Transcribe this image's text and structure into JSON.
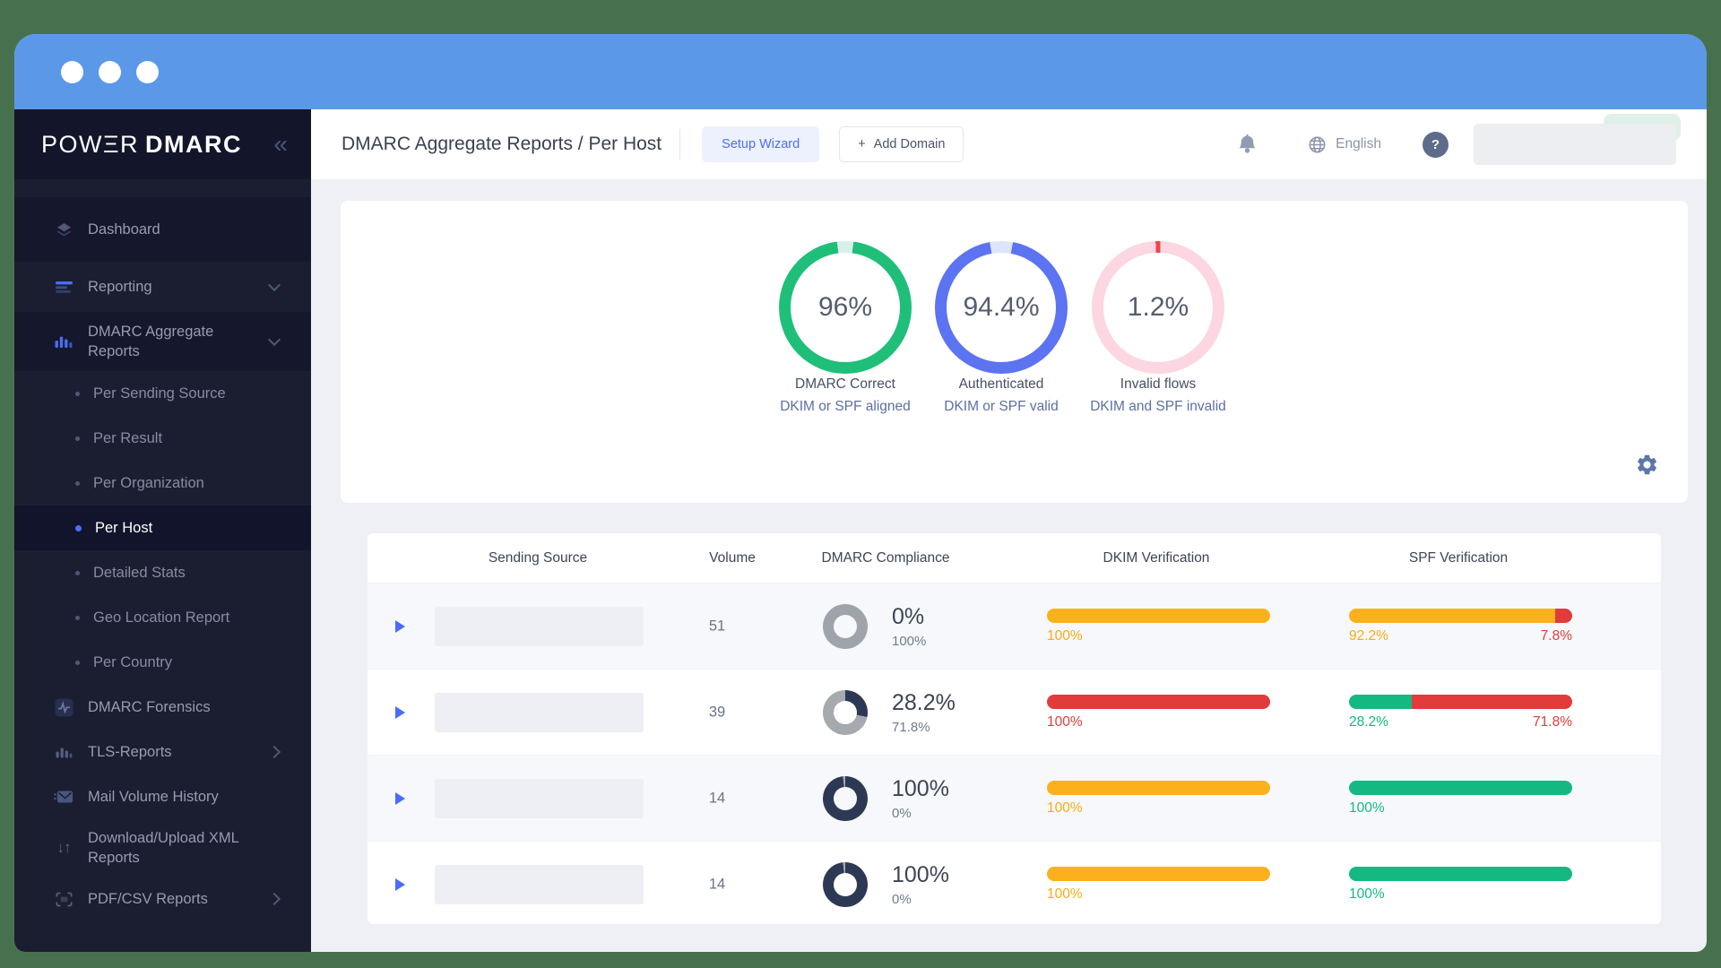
{
  "colors": {
    "desktop": "#47714e",
    "titlebar": "#5b99e8",
    "accent_blue": "#4c6cf5",
    "green": "#1fbf79",
    "amber": "#fbb11c",
    "red": "#e23b3c",
    "teal_green": "#14b981",
    "navy": "#2d3954",
    "pink": "#fcd6e0"
  },
  "sidebar": {
    "logo": {
      "thin": "POWΞR",
      "bold": "DMARC"
    },
    "collapse_glyph": "«",
    "items": [
      {
        "label": "Dashboard"
      },
      {
        "label": "Reporting"
      },
      {
        "label": "DMARC Aggregate Reports"
      },
      {
        "label": "Per Sending Source"
      },
      {
        "label": "Per Result"
      },
      {
        "label": "Per Organization"
      },
      {
        "label": "Per Host"
      },
      {
        "label": "Detailed Stats"
      },
      {
        "label": "Geo Location Report"
      },
      {
        "label": "Per Country"
      },
      {
        "label": "DMARC Forensics"
      },
      {
        "label": "TLS-Reports"
      },
      {
        "label": "Mail Volume History"
      },
      {
        "label": "Download/Upload XML Reports"
      },
      {
        "label": "PDF/CSV Reports"
      }
    ]
  },
  "header": {
    "title": "DMARC Aggregate Reports / Per Host",
    "setup_wizard_label": "Setup Wizard",
    "add_domain_plus": "+",
    "add_domain_label": "Add Domain",
    "language": "English",
    "help_glyph": "?"
  },
  "summary": {
    "donuts": [
      {
        "value": "96%",
        "line1": "DMARC Correct",
        "line2": "DKIM or SPF aligned",
        "start": -7.2,
        "segments": [
          {
            "pct": 4,
            "color": "#d9f0ea"
          },
          {
            "pct": 96,
            "color": "#1fbf79"
          }
        ]
      },
      {
        "value": "94.4%",
        "line1": "Authenticated",
        "line2": "DKIM or SPF valid",
        "start": -10,
        "segments": [
          {
            "pct": 5.6,
            "color": "#dde4fc"
          },
          {
            "pct": 94.4,
            "color": "#5c73f2"
          }
        ]
      },
      {
        "value": "1.2%",
        "line1": "Invalid flows",
        "line2": "DKIM and SPF invalid",
        "start": -2.2,
        "segments": [
          {
            "pct": 1.2,
            "color": "#e9494f"
          },
          {
            "pct": 98.8,
            "color": "#fcd6e0"
          }
        ]
      }
    ]
  },
  "table": {
    "columns": [
      "Sending Source",
      "Volume",
      "DMARC Compliance",
      "DKIM Verification",
      "SPF Verification"
    ],
    "rows": [
      {
        "volume": "51",
        "compliance": {
          "value": "0%",
          "sub": "100%",
          "donut": {
            "start": 0,
            "segments": [
              {
                "pct": 100,
                "color": "#9fa3ab"
              }
            ]
          }
        },
        "dkim": {
          "segments": [
            {
              "pct": 100,
              "color": "#fbb11c"
            }
          ],
          "labels": [
            {
              "text": "100%",
              "color": "#f9ab13"
            }
          ]
        },
        "spf": {
          "segments": [
            {
              "pct": 92.2,
              "color": "#fbb11c"
            },
            {
              "pct": 7.8,
              "color": "#e23b3c"
            }
          ],
          "labels": [
            {
              "text": "92.2%",
              "color": "#f9ab13"
            },
            {
              "text": "7.8%",
              "color": "#e23b3c"
            }
          ]
        }
      },
      {
        "volume": "39",
        "compliance": {
          "value": "28.2%",
          "sub": "71.8%",
          "donut": {
            "start": 0,
            "segments": [
              {
                "pct": 28.2,
                "color": "#2d3954"
              },
              {
                "pct": 71.8,
                "color": "#a6a9ae"
              }
            ]
          }
        },
        "dkim": {
          "segments": [
            {
              "pct": 100,
              "color": "#e23b3c"
            }
          ],
          "labels": [
            {
              "text": "100%",
              "color": "#e23b3c"
            }
          ]
        },
        "spf": {
          "segments": [
            {
              "pct": 28.2,
              "color": "#14b981"
            },
            {
              "pct": 71.8,
              "color": "#e23b3c"
            }
          ],
          "labels": [
            {
              "text": "28.2%",
              "color": "#14b981"
            },
            {
              "text": "71.8%",
              "color": "#e23b3c"
            }
          ]
        }
      },
      {
        "volume": "14",
        "compliance": {
          "value": "100%",
          "sub": "0%",
          "donut": {
            "start": -6,
            "segments": [
              {
                "pct": 1.7,
                "color": "#a6a9ae"
              },
              {
                "pct": 98.3,
                "color": "#2d3954"
              }
            ]
          }
        },
        "dkim": {
          "segments": [
            {
              "pct": 100,
              "color": "#fbb11c"
            }
          ],
          "labels": [
            {
              "text": "100%",
              "color": "#f9ab13"
            }
          ]
        },
        "spf": {
          "segments": [
            {
              "pct": 100,
              "color": "#14b981"
            }
          ],
          "labels": [
            {
              "text": "100%",
              "color": "#14b981"
            }
          ]
        }
      },
      {
        "volume": "14",
        "compliance": {
          "value": "100%",
          "sub": "0%",
          "donut": {
            "start": -6,
            "segments": [
              {
                "pct": 1.7,
                "color": "#a6a9ae"
              },
              {
                "pct": 98.3,
                "color": "#2d3954"
              }
            ]
          }
        },
        "dkim": {
          "segments": [
            {
              "pct": 100,
              "color": "#fbb11c"
            }
          ],
          "labels": [
            {
              "text": "100%",
              "color": "#f9ab13"
            }
          ]
        },
        "spf": {
          "segments": [
            {
              "pct": 100,
              "color": "#14b981"
            }
          ],
          "labels": [
            {
              "text": "100%",
              "color": "#14b981"
            }
          ]
        }
      }
    ]
  }
}
